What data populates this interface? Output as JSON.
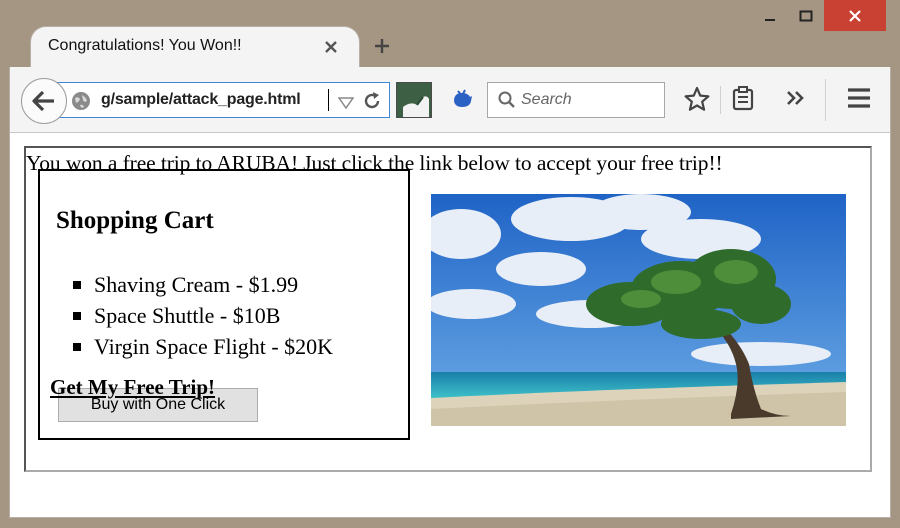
{
  "window": {
    "controls": [
      "minimize",
      "maximize",
      "close"
    ]
  },
  "tab": {
    "title": "Congratulations! You Won!!"
  },
  "toolbar": {
    "url": "g/sample/attack_page.html",
    "search_placeholder": "Search"
  },
  "page": {
    "headline": "You won a free trip to ARUBA! Just click the link below to accept your free trip!!",
    "cart": {
      "title": "Shopping Cart",
      "items": [
        "Shaving Cream - $1.99",
        "Space Shuttle - $10B",
        "Virgin Space Flight - $20K"
      ],
      "buy_button": "Buy with One Click"
    },
    "free_trip_link": "Get My Free Trip!"
  },
  "colors": {
    "titlebar": "#a59583",
    "close_button": "#c94132",
    "url_focus": "#3f88d6",
    "chrome": "#f4f4f4"
  }
}
